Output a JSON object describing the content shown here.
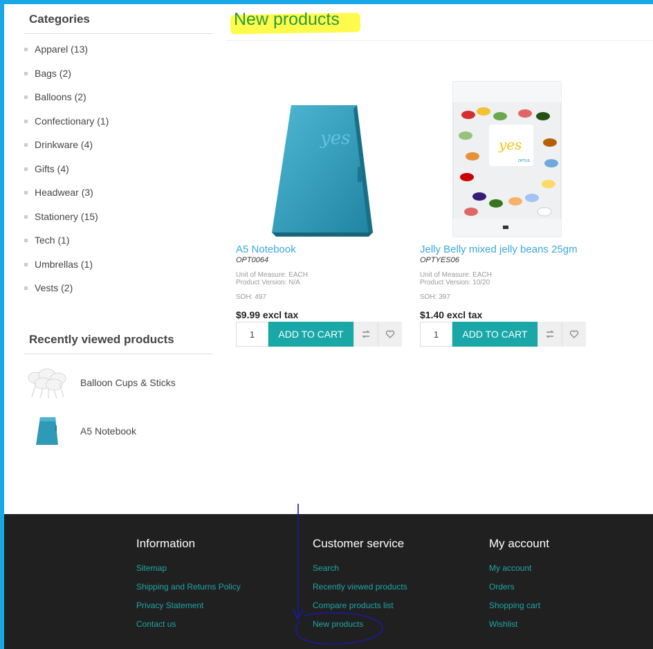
{
  "sidebar": {
    "categories_title": "Categories",
    "categories": [
      "Apparel (13)",
      "Bags (2)",
      "Balloons (2)",
      "Confectionary (1)",
      "Drinkware (4)",
      "Gifts (4)",
      "Headwear (3)",
      "Stationery (15)",
      "Tech (1)",
      "Umbrellas (1)",
      "Vests (2)"
    ],
    "recent_title": "Recently viewed products",
    "recent": [
      {
        "name": "Balloon Cups & Sticks",
        "icon": "balloon-cups-image"
      },
      {
        "name": "A5 Notebook",
        "icon": "notebook-image"
      }
    ]
  },
  "main": {
    "title": "New products",
    "products": [
      {
        "name": "A5 Notebook",
        "sku": "OPT0064",
        "unit": "Unit of Measure: EACH",
        "version": "Product Version: N/A",
        "soh": "SOH: 497",
        "price": "$9.99 excl tax",
        "qty": "1",
        "cart_label": "ADD TO CART",
        "image_text": "yes"
      },
      {
        "name": "Jelly Belly mixed jelly beans 25gm",
        "sku": "OPTYES06",
        "unit": "Unit of Measure: EACH",
        "version": "Product Version: 10/20",
        "soh": "SOH: 397",
        "price": "$1.40 excl tax",
        "qty": "1",
        "cart_label": "ADD TO CART",
        "image_text": "yes",
        "image_subtext": "OPTUS"
      }
    ]
  },
  "footer": {
    "information": {
      "title": "Information",
      "links": [
        "Sitemap",
        "Shipping and Returns Policy",
        "Privacy Statement",
        "Contact us"
      ]
    },
    "customer_service": {
      "title": "Customer service",
      "links": [
        "Search",
        "Recently viewed products",
        "Compare products list",
        "New products"
      ]
    },
    "my_account": {
      "title": "My account",
      "links": [
        "My account",
        "Orders",
        "Shopping cart",
        "Wishlist"
      ]
    }
  },
  "colors": {
    "frame": "#1aa7e6",
    "accent": "#1aa7a8",
    "link": "#3aa7de",
    "title_green": "#2c9a3a",
    "highlight": "#fffb3a",
    "footer_bg": "#202020",
    "annotation": "#1a1aa8"
  }
}
